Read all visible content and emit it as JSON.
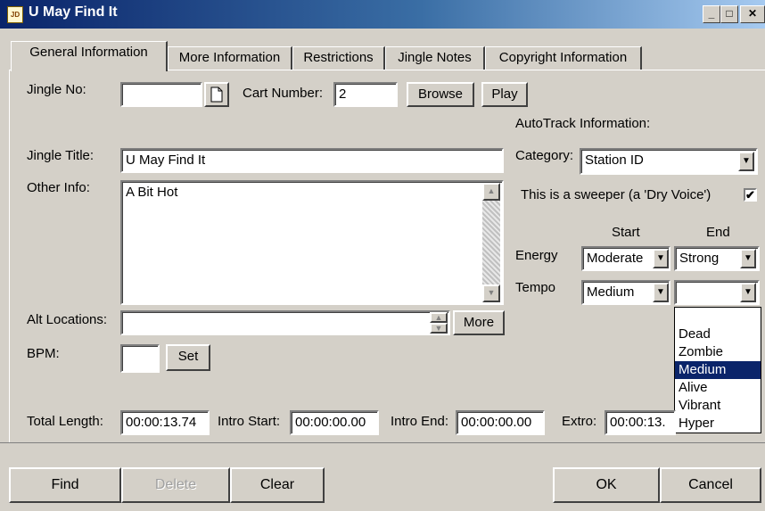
{
  "window": {
    "title": "U May Find It",
    "icon_label": "JD"
  },
  "tabs": [
    "General Information",
    "More Information",
    "Restrictions",
    "Jingle Notes",
    "Copyright Information"
  ],
  "form": {
    "jingle_no_label": "Jingle No:",
    "jingle_no_value": "",
    "cart_number_label": "Cart Number:",
    "cart_number_value": "2",
    "browse_label": "Browse",
    "play_label": "Play",
    "jingle_title_label": "Jingle Title:",
    "jingle_title_value": "U May Find It",
    "other_info_label": "Other Info:",
    "other_info_value": "A Bit Hot",
    "alt_locations_label": "Alt Locations:",
    "alt_locations_value": "",
    "more_label": "More",
    "bpm_label": "BPM:",
    "bpm_value": "",
    "set_label": "Set",
    "total_length_label": "Total Length:",
    "total_length_value": "00:00:13.74",
    "intro_start_label": "Intro Start:",
    "intro_start_value": "00:00:00.00",
    "intro_end_label": "Intro End:",
    "intro_end_value": "00:00:00.00",
    "extro_label": "Extro:",
    "extro_value": "00:00:13."
  },
  "autotrack": {
    "heading": "AutoTrack Information:",
    "category_label": "Category:",
    "category_value": "Station ID",
    "sweeper_label": "This is a sweeper (a 'Dry Voice')",
    "sweeper_checked": "✔",
    "start_label": "Start",
    "end_label": "End",
    "energy_label": "Energy",
    "energy_start": "Moderate",
    "energy_end": "Strong",
    "tempo_label": "Tempo",
    "tempo_start": "Medium",
    "tempo_end": ""
  },
  "tempo_dropdown": {
    "options": [
      "Dead",
      "Zombie",
      "Medium",
      "Alive",
      "Vibrant",
      "Hyper"
    ],
    "selected": "Medium"
  },
  "buttons": {
    "find": "Find",
    "delete": "Delete",
    "clear": "Clear",
    "ok": "OK",
    "cancel": "Cancel"
  },
  "colors": {
    "title_bar": "#0a246a",
    "selection": "#0a246a",
    "face": "#d4d0c8"
  }
}
